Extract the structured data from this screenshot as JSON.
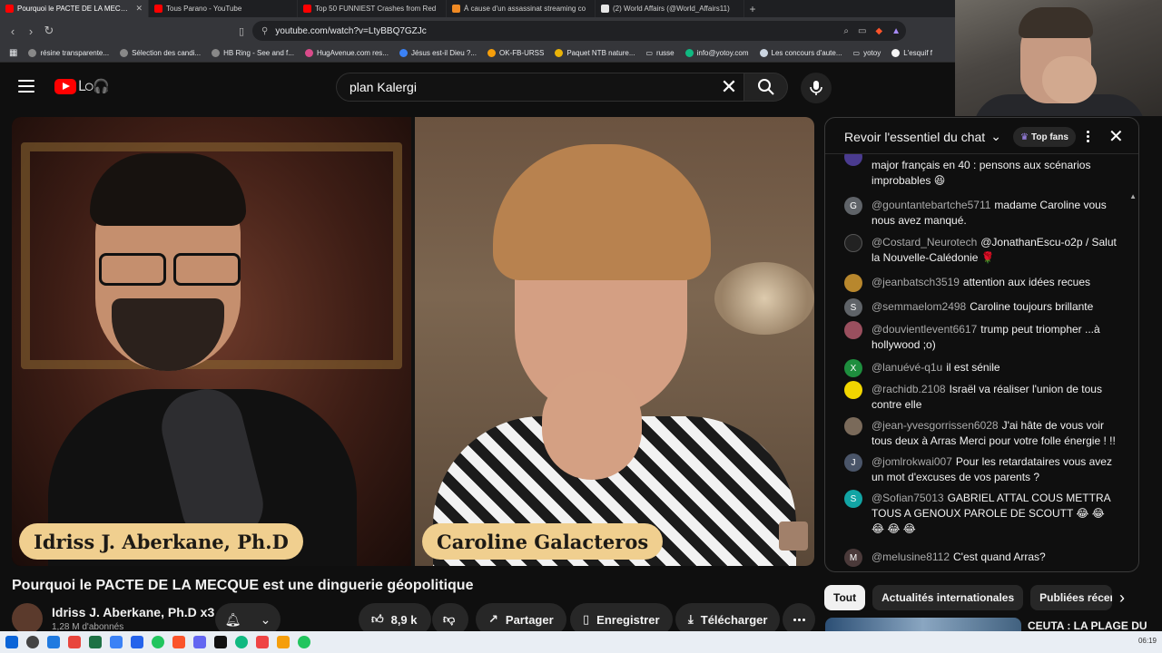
{
  "browser": {
    "tabs": [
      {
        "title": "Pourquoi le PACTE DE LA MECQUE",
        "active": true,
        "favicon_color": "#ff0000"
      },
      {
        "title": "Tous Parano - YouTube",
        "active": false,
        "favicon_color": "#ff0000"
      },
      {
        "title": "Top 50 FUNNIEST Crashes from Red",
        "active": false,
        "favicon_color": "#ff0000"
      },
      {
        "title": "À cause d'un assassinat streaming co",
        "active": false,
        "favicon_color": "#f08a24"
      },
      {
        "title": "(2) World Affairs (@World_Affairs11)",
        "active": false,
        "favicon_color": "#e6e6e6"
      }
    ],
    "new_tab": "+",
    "url": "youtube.com/watch?v=LtyBBQ7GZJc",
    "bookmarks": [
      "résine transparente...",
      "Sélection des candi...",
      "HB Ring - See and f...",
      "HugAvenue.com res...",
      "Jésus est-il Dieu ?...",
      "OK-FB-URSS",
      "Paquet NTB nature...",
      "russe",
      "info@yotoy.com",
      "Les concours d'aute...",
      "yotoy",
      "L'esquif f"
    ]
  },
  "youtube": {
    "search_value": "plan Kalergi",
    "colors": {
      "brand": "#ff0000",
      "background": "#0f0f0f",
      "surface": "#272727"
    },
    "video": {
      "left_name": "Idriss J. Aberkane, Ph.D",
      "right_name": "Caroline Galacteros"
    },
    "title": "Pourquoi le PACTE DE LA MECQUE est une dinguerie géopolitique",
    "channel": {
      "name": "Idriss J. Aberkane, Ph.D x3",
      "subscribers": "1,28 M d'abonnés"
    },
    "actions": {
      "likes": "8,9 k",
      "share": "Partager",
      "save": "Enregistrer",
      "download": "Télécharger"
    },
    "chat": {
      "title": "Revoir l'essentiel du chat",
      "top_fans": "Top fans",
      "messages": [
        {
          "author": "",
          "text": "major français en 40 : pensons aux scénarios improbables 😆",
          "avatar_letter": "",
          "avatar_color": "#4a3b8f"
        },
        {
          "author": "@gountantebartche5711",
          "text": "madame Caroline vous nous avez manqué.",
          "avatar_letter": "G",
          "avatar_color": "#5f6368"
        },
        {
          "author": "@Costard_Neurotech",
          "text": "@JonathanEscu-o2p / Salut la Nouvelle-Calédonie 🌹",
          "avatar_letter": "",
          "avatar_color": "#222222"
        },
        {
          "author": "@jeanbatsch3519",
          "text": "attention aux idées recues",
          "avatar_letter": "",
          "avatar_color": "#b8872d"
        },
        {
          "author": "@semmaelom2498",
          "text": "Caroline toujours brillante",
          "avatar_letter": "S",
          "avatar_color": "#5f6368"
        },
        {
          "author": "@douvientlevent6617",
          "text": "trump peut triompher ...à hollywood ;o)",
          "avatar_letter": "",
          "avatar_color": "#9a4f5e"
        },
        {
          "author": "@lanuévé-q1u",
          "text": "il est sénile",
          "avatar_letter": "X",
          "avatar_color": "#1e8e3e"
        },
        {
          "author": "@rachidb.2108",
          "text": "Israël va réaliser l'union de tous contre elle",
          "avatar_letter": "",
          "avatar_color": "#f2d600"
        },
        {
          "author": "@jean-yvesgorrissen6028",
          "text": "J'ai hâte de vous voir tous deux à Arras Merci pour votre folle énergie ! !!",
          "avatar_letter": "",
          "avatar_color": "#7a6a5a"
        },
        {
          "author": "@jomlrokwai007",
          "text": "Pour les retardataires vous avez un mot d'excuses de vos parents ?",
          "avatar_letter": "J",
          "avatar_color": "#4a5569"
        },
        {
          "author": "@Sofian75013",
          "text": "GABRIEL ATTAL COUS METTRA TOUS A GENOUX PAROLE DE SCOUTT 😂 😂 😂 😂 😂",
          "avatar_letter": "S",
          "avatar_color": "#12a4a4"
        },
        {
          "author": "@melusine8112",
          "text": "C'est quand Arras?",
          "avatar_letter": "M",
          "avatar_color": "#4b3a3a"
        }
      ]
    },
    "chips": [
      "Tout",
      "Actualités internationales",
      "Publiées récem"
    ],
    "recommendation_title": "CEUTA : LA PLAGE DU"
  },
  "taskbar": {
    "time": "06:19"
  }
}
